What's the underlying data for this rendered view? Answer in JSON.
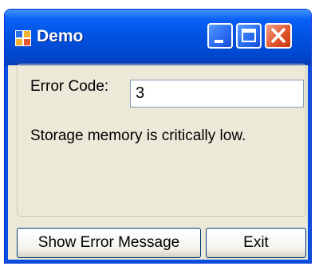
{
  "window": {
    "title": "Demo",
    "app_icon": "windows-form-icon",
    "controls": {
      "minimize": "minimize-icon",
      "maximize": "maximize-icon",
      "close": "close-icon"
    }
  },
  "form": {
    "error_code_label": "Error Code:",
    "error_code_value": "3",
    "message": "Storage memory is critically low."
  },
  "buttons": {
    "show_error": "Show Error Message",
    "exit": "Exit"
  },
  "colors": {
    "titlebar": "#0054e3",
    "window_bg": "#ece9d8",
    "close_button": "#e2582f"
  }
}
